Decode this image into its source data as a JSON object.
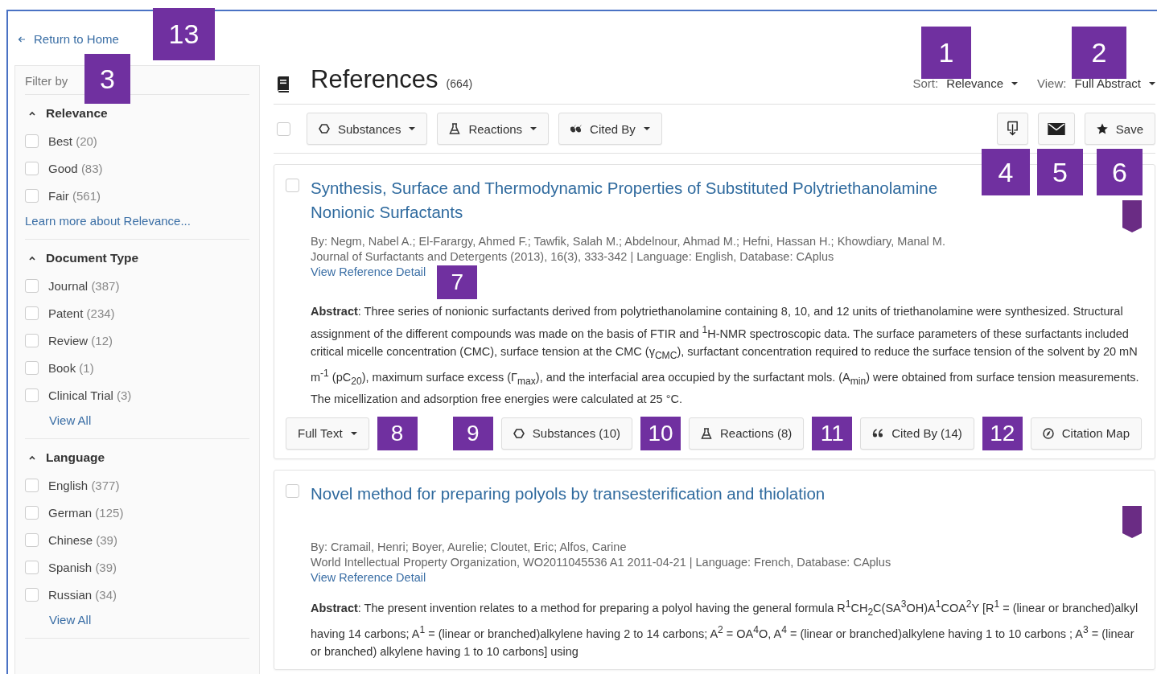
{
  "back_link": {
    "label": "Return to Home"
  },
  "filters": {
    "title": "Filter by",
    "sections": [
      {
        "title": "Relevance",
        "expanded": true,
        "items": [
          {
            "label": "Best",
            "count": "(20)",
            "checked": false
          },
          {
            "label": "Good",
            "count": "(83)",
            "checked": false
          },
          {
            "label": "Fair",
            "count": "(561)",
            "checked": false
          }
        ],
        "link": "Learn more about Relevance...",
        "link_indented": false
      },
      {
        "title": "Document Type",
        "expanded": true,
        "items": [
          {
            "label": "Journal",
            "count": "(387)",
            "checked": false
          },
          {
            "label": "Patent",
            "count": "(234)",
            "checked": false
          },
          {
            "label": "Review",
            "count": "(12)",
            "checked": false
          },
          {
            "label": "Book",
            "count": "(1)",
            "checked": false
          },
          {
            "label": "Clinical Trial",
            "count": "(3)",
            "checked": false
          }
        ],
        "link": "View All",
        "link_indented": true
      },
      {
        "title": "Language",
        "expanded": true,
        "items": [
          {
            "label": "English",
            "count": "(377)",
            "checked": false
          },
          {
            "label": "German",
            "count": "(125)",
            "checked": false
          },
          {
            "label": "Chinese",
            "count": "(39)",
            "checked": false
          },
          {
            "label": "Spanish",
            "count": "(39)",
            "checked": false
          },
          {
            "label": "Russian",
            "count": "(34)",
            "checked": false
          }
        ],
        "link": "View All",
        "link_indented": true
      }
    ]
  },
  "header": {
    "title": "References",
    "count": "(664)",
    "sort_label": "Sort:",
    "sort_value": "Relevance",
    "view_label": "View:",
    "view_value": "Full Abstract"
  },
  "toolbar": {
    "select_all_checked": false,
    "buttons": [
      {
        "kind": "substances",
        "label": "Substances"
      },
      {
        "kind": "reactions",
        "label": "Reactions"
      },
      {
        "kind": "cited",
        "label": "Cited By"
      }
    ],
    "save_label": "Save"
  },
  "results": [
    {
      "checked": false,
      "title": "Synthesis, Surface and Thermodynamic Properties of Substituted Polytriethanolamine Nonionic Surfactants",
      "authors": "By: Negm, Nabel A.; El-Farargy, Ahmed F.; Tawfik, Salah M.; Abdelnour, Ahmad M.; Hefni, Hassan H.; Khowdiary, Manal M.",
      "source": "Journal of Surfactants and Detergents (2013), 16(3), 333-342 | Language: English, Database: CAplus",
      "detail_link": "View Reference Detail",
      "abstract": "**Abstract**: Three series of nonionic surfactants derived from polytriethanolamine containing 8, 10, and 12 units of triethanolamine were synthesized. Structural assignment of the different compounds was made on the basis of FTIR and $^{1}$H-NMR spectroscopic data. The surface parameters of these surfactants included critical micelle concentration (CMC), surface tension at the CMC (γ$_{CMC}$), surfactant concentration required to reduce the surface tension of the solvent by 20 mN m$^{-1}$ (pC$_{20}$), maximum surface excess (Γ$_{max}$), and the interfacial area occupied by the surfactant mols. (A$_{min}$) were obtained from surface tension measurements. The micellization and adsorption free energies were calculated at 25 °C.",
      "full_text": "Full Text",
      "actions": [
        {
          "kind": "substances",
          "label": "Substances (10)"
        },
        {
          "kind": "reactions",
          "label": "Reactions (8)"
        },
        {
          "kind": "cited",
          "label": "Cited By (14)"
        },
        {
          "kind": "map",
          "label": "Citation Map"
        }
      ]
    },
    {
      "checked": false,
      "title": "Novel method for preparing polyols by transesterification and thiolation",
      "authors": "By: Cramail, Henri; Boyer, Aurelie; Cloutet, Eric; Alfos, Carine",
      "source": "World Intellectual Property Organization, WO2011045536 A1 2011-04-21 | Language: French, Database: CAplus",
      "detail_link": "View Reference Detail",
      "abstract": "**Abstract**: The present invention relates to a method for preparing a polyol having the general formula R$^{1}$CH$_{2}$C(SA$^{3}$OH)A$^{1}$COA$^{2}$Y [R$^{1}$ = (linear or branched)alkyl having 14 carbons; A$^{1}$ = (linear or branched)alkylene having 2 to 14 carbons; A$^{2}$ = OA$^{4}$O, A$^{4}$ = (linear or branched)alkylene having 1 to 10 carbons ; A$^{3}$ = (linear or branched) alkylene having 1 to 10 carbons] using"
    }
  ],
  "callouts": [
    "1",
    "2",
    "3",
    "4",
    "5",
    "6",
    "7",
    "8",
    "9",
    "10",
    "11",
    "12",
    "13"
  ]
}
